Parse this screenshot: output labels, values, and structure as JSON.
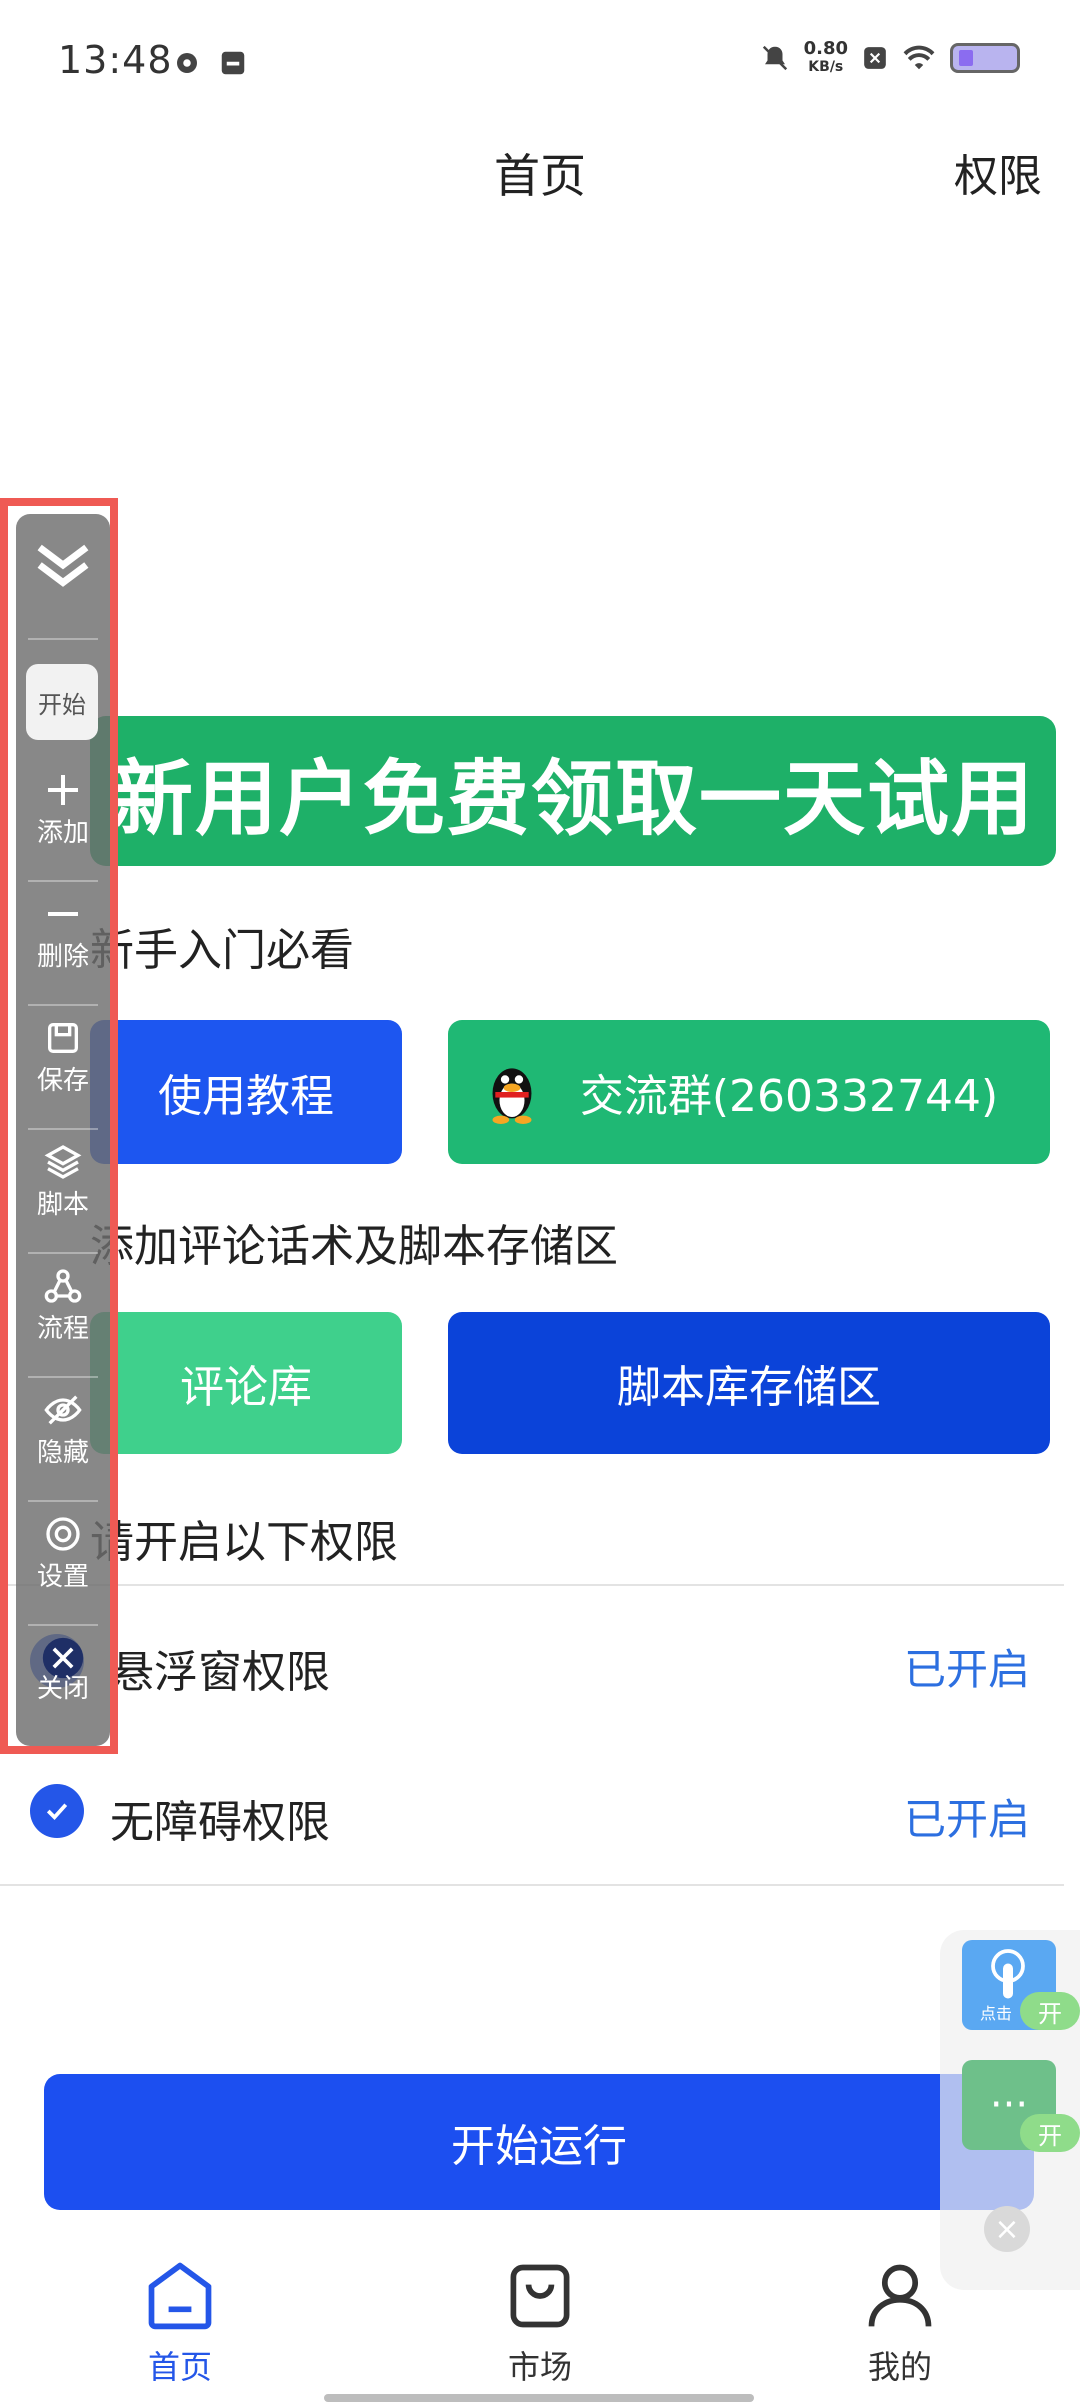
{
  "status": {
    "time": "13:48",
    "net_speed": "0.80",
    "net_unit": "KB/s"
  },
  "header": {
    "title": "首页",
    "permissions": "权限"
  },
  "banner": {
    "text": "新用户免费领取一天试用"
  },
  "sections": {
    "beginner": "新手入门必看",
    "add_comments": "添加评论话术及脚本存储区",
    "enable_perms": "请开启以下权限"
  },
  "buttons": {
    "tutorial": "使用教程",
    "group": "交流群(260332744)",
    "comment_lib": "评论库",
    "script_lib": "脚本库存储区",
    "run": "开始运行"
  },
  "permissions": [
    {
      "label": "悬浮窗权限",
      "state": "已开启"
    },
    {
      "label": "无障碍权限",
      "state": "已开启"
    }
  ],
  "toolbar": {
    "start": "开始",
    "items": [
      "添加",
      "删除",
      "保存",
      "脚本",
      "流程",
      "隐藏",
      "设置",
      "关闭"
    ]
  },
  "float": {
    "click_label": "点击",
    "open1": "开",
    "open2": "开",
    "more": "···"
  },
  "nav": {
    "home": "首页",
    "market": "市场",
    "mine": "我的"
  },
  "colors": {
    "primary": "#1d56f0",
    "green": "#1fb874",
    "toolbar_border": "#ef5a54"
  }
}
